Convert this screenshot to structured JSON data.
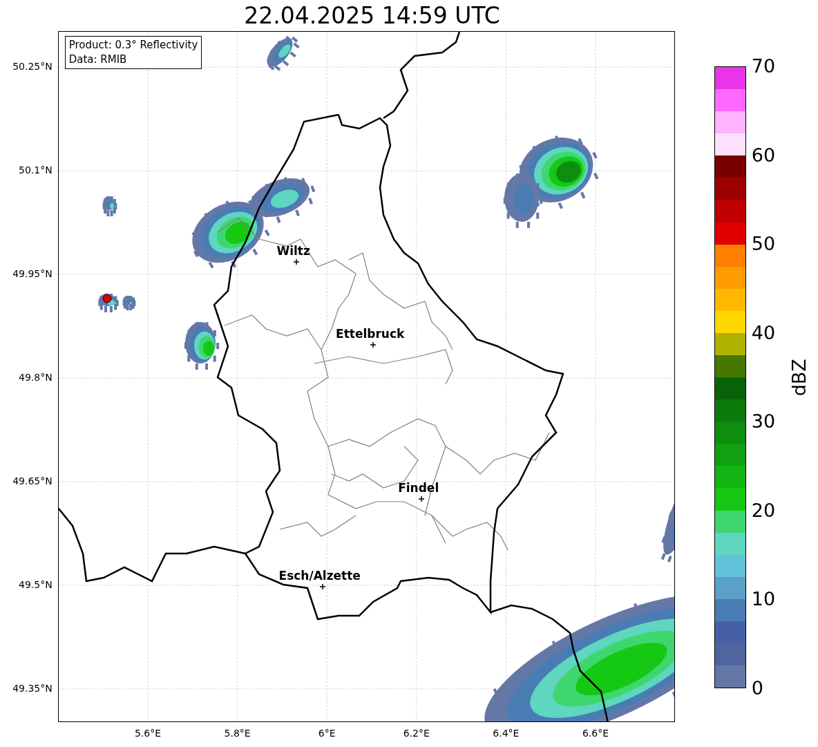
{
  "title": "22.04.2025 14:59 UTC",
  "map": {
    "info": [
      "Product: 0.3° Reflectivity",
      "Data: RMIB"
    ],
    "y_ticks": [
      "50.25°N",
      "50.1°N",
      "49.95°N",
      "49.8°N",
      "49.65°N",
      "49.5°N",
      "49.35°N"
    ],
    "x_ticks": [
      "5.6°E",
      "5.8°E",
      "6°E",
      "6.2°E",
      "6.4°E",
      "6.6°E"
    ],
    "cities": [
      {
        "name": "Wiltz"
      },
      {
        "name": "Ettelbruck"
      },
      {
        "name": "Findel"
      },
      {
        "name": "Esch/Alzette"
      }
    ]
  },
  "colorbar": {
    "label": "dBZ",
    "ticks": [
      "70",
      "60",
      "50",
      "40",
      "30",
      "20",
      "10",
      "0"
    ],
    "bands": [
      {
        "color": "#e935e9"
      },
      {
        "color": "#fd6afd"
      },
      {
        "color": "#fdb3fd"
      },
      {
        "color": "#fde0fd"
      },
      {
        "color": "#7a0000"
      },
      {
        "color": "#9d0000"
      },
      {
        "color": "#c00000"
      },
      {
        "color": "#e10000"
      },
      {
        "color": "#ff7f00"
      },
      {
        "color": "#ff9c00"
      },
      {
        "color": "#ffb800"
      },
      {
        "color": "#ffd700"
      },
      {
        "color": "#b1b100"
      },
      {
        "color": "#467800"
      },
      {
        "color": "#086308"
      },
      {
        "color": "#0c7a0c"
      },
      {
        "color": "#0e8e0e"
      },
      {
        "color": "#10a010"
      },
      {
        "color": "#12b512"
      },
      {
        "color": "#14c814"
      },
      {
        "color": "#3ed76e"
      },
      {
        "color": "#5ed6c0"
      },
      {
        "color": "#64c3dc"
      },
      {
        "color": "#5aa0c8"
      },
      {
        "color": "#4a7cb4"
      },
      {
        "color": "#4660a8"
      },
      {
        "color": "#5064a0"
      },
      {
        "color": "#6478a8"
      }
    ]
  }
}
